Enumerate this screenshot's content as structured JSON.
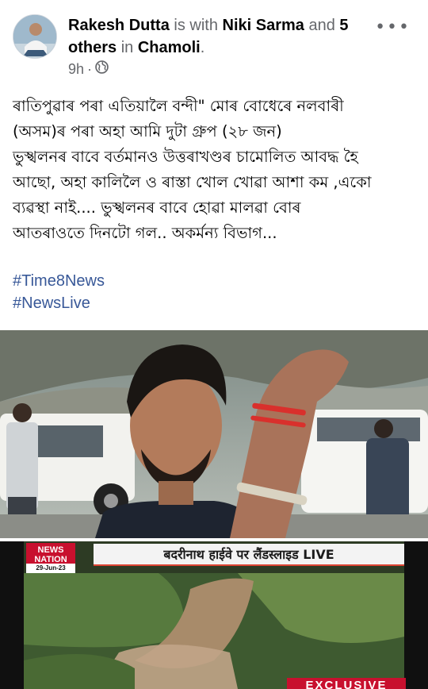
{
  "post": {
    "author": "Rakesh Dutta",
    "with_text": "is with",
    "tagged": "Niki Sarma",
    "and_text": "and",
    "others": "5 others",
    "in_text": "in",
    "location": "Chamoli",
    "period": ".",
    "time": "9h",
    "separator": "·",
    "more": "•••",
    "body_lines": [
      "ৰাতিপুৱাৰ পৰা এতিয়ালৈ বন্দী\" মোৰ বোধেৰে নলবাৰী",
      "(অসম)ৰ পৰা অহা আমি দুটা গ্ৰুপ (২৮ জন)",
      "ভুস্খলনৰ বাবে বৰ্তমানও উত্তৰাখণ্ডৰ চামোলিত আবদ্ধ হৈ",
      "আছো, অহা কালিলৈ ও ৰাস্তা খোল খোৱা আশা কম ,একো",
      "ব্যৱস্থা নাই.... ভুস্খলনৰ বাবে হোৱা মালৱা বোৰ",
      "আতৰাওতে দিনটো গল.. অকৰ্মন্য বিভাগ..."
    ],
    "hashtags": [
      "#Time8News",
      "#NewsLive"
    ]
  },
  "news_frame": {
    "channel": "NEWS NATION",
    "date": "29-Jun-23",
    "headline": "बदरीनाथ हाईवे पर लैंडस्लाइड LIVE",
    "tag": "EXCLUSIVE"
  },
  "colors": {
    "link": "#385898",
    "meta": "#65676b",
    "text": "#050505",
    "channel_red": "#c8102e"
  }
}
